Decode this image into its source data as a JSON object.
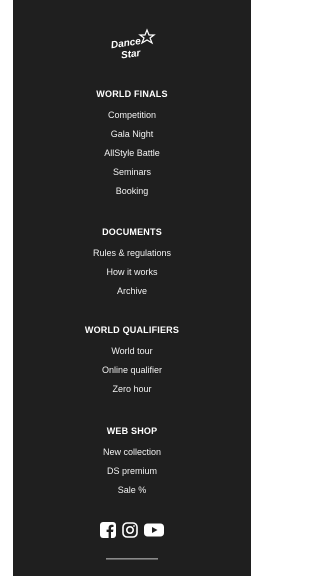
{
  "logo": {
    "text_top": "Dance",
    "text_bottom": "Star"
  },
  "sections": [
    {
      "title": "WORLD FINALS",
      "items": [
        "Competition",
        "Gala Night",
        "AllStyle Battle",
        "Seminars",
        "Booking"
      ]
    },
    {
      "title": "DOCUMENTS",
      "items": [
        "Rules & regulations",
        "How it works",
        "Archive"
      ]
    },
    {
      "title": "WORLD QUALIFIERS",
      "items": [
        "World tour",
        "Online qualifier",
        "Zero hour"
      ]
    },
    {
      "title": "WEB SHOP",
      "items": [
        "New collection",
        "DS premium",
        "Sale %"
      ]
    }
  ],
  "social": {
    "icons": [
      "facebook-icon",
      "instagram-icon",
      "youtube-icon"
    ]
  },
  "colors": {
    "background": "#1f1f1f",
    "text": "#ffffff",
    "page": "#ffffff"
  }
}
